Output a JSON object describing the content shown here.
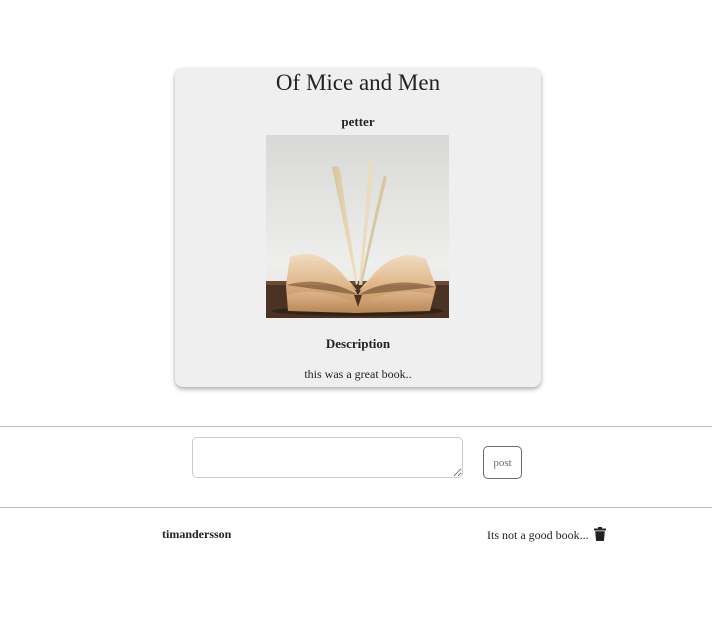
{
  "book": {
    "title": "Of Mice and Men",
    "author": "petter",
    "image_icon": "open-book-photo",
    "description_heading": "Description",
    "description": "this was a great book.."
  },
  "comment_form": {
    "textarea_value": "",
    "post_label": "post"
  },
  "comments": [
    {
      "user": "timandersson",
      "text": "Its not a good book...",
      "delete_icon": "trash-icon"
    }
  ]
}
